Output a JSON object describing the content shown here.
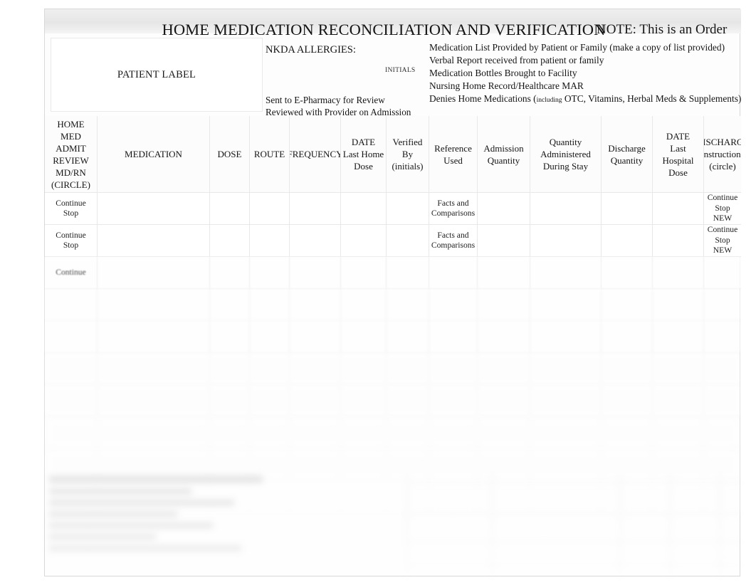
{
  "document": {
    "title_main": "HOME MEDICATION RECONCILIATION AND VERIFICATION",
    "title_note": "NOTE: This is an Order"
  },
  "header": {
    "patient_label": "PATIENT LABEL",
    "allergies_label": "NKDA ALLERGIES:",
    "initials_label": "INITIALS",
    "allergy_actions": [
      "Sent to E-Pharmacy for Review",
      "Reviewed with Provider on Admission"
    ],
    "information_sources": [
      "Medication List Provided by Patient or Family (make a copy of list provided)",
      "Verbal Report received from patient or family",
      "Medication Bottles Brought to Facility",
      "Nursing Home Record/Healthcare MAR"
    ],
    "denies_prefix": "Denies Home Medications (",
    "denies_small": "including",
    "denies_suffix": " OTC, Vitamins, Herbal Meds & Supplements)"
  },
  "table": {
    "columns": [
      {
        "key": "review",
        "label": "HOME MED ADMIT REVIEW MD/RN (CIRCLE)",
        "lines": [
          "HOME",
          "MED",
          "ADMIT",
          "REVIEW",
          "MD/RN",
          "(CIRCLE)"
        ]
      },
      {
        "key": "medication",
        "label": "MEDICATION",
        "lines": [
          "MEDICATION"
        ]
      },
      {
        "key": "dose",
        "label": "DOSE",
        "lines": [
          "DOSE"
        ]
      },
      {
        "key": "route",
        "label": "ROUTE",
        "lines": [
          "ROUTE"
        ]
      },
      {
        "key": "frequency",
        "label": "FREQUENCY",
        "lines": [
          "FREQUENCY"
        ]
      },
      {
        "key": "date_last_home_dose",
        "label": "DATE Last Home Dose",
        "lines": [
          "DATE",
          "Last Home",
          "Dose"
        ]
      },
      {
        "key": "verified_by",
        "label": "Verified By (initials)",
        "lines": [
          "Verified",
          "By",
          "(initials)"
        ]
      },
      {
        "key": "reference_used",
        "label": "Reference Used",
        "lines": [
          "Reference",
          "Used"
        ]
      },
      {
        "key": "admission_quantity",
        "label": "Admission Quantity",
        "lines": [
          "Admission",
          "Quantity"
        ]
      },
      {
        "key": "quantity_administered",
        "label": "Quantity Administered During Stay",
        "lines": [
          "Quantity",
          "Administered",
          "During Stay"
        ]
      },
      {
        "key": "discharge_quantity",
        "label": "Discharge Quantity",
        "lines": [
          "Discharge",
          "Quantity"
        ]
      },
      {
        "key": "date_last_hospital_dose",
        "label": "DATE Last Hospital Dose",
        "lines": [
          "DATE",
          "Last",
          "Hospital",
          "Dose"
        ]
      },
      {
        "key": "discharge_instructions",
        "label": "DISCHARGE Instructions (circle)",
        "lines": [
          "DISCHARGE",
          "Instructions",
          "(circle)"
        ]
      }
    ],
    "rows": [
      {
        "review": [
          "Continue",
          "Stop"
        ],
        "medication": "",
        "dose": "",
        "route": "",
        "frequency": "",
        "date_last_home_dose": "",
        "verified_by": "",
        "reference_used": [
          "Facts and",
          "Comparisons"
        ],
        "admission_quantity": "",
        "quantity_administered": "",
        "discharge_quantity": "",
        "date_last_hospital_dose": "",
        "discharge_instructions": [
          "Continue",
          "Stop",
          "NEW"
        ]
      },
      {
        "review": [
          "Continue",
          "Stop"
        ],
        "medication": "",
        "dose": "",
        "route": "",
        "frequency": "",
        "date_last_home_dose": "",
        "verified_by": "",
        "reference_used": [
          "Facts and",
          "Comparisons"
        ],
        "admission_quantity": "",
        "quantity_administered": "",
        "discharge_quantity": "",
        "date_last_hospital_dose": "",
        "discharge_instructions": [
          "Continue",
          "Stop",
          "NEW"
        ]
      },
      {
        "review": [
          "Continue"
        ],
        "medication": "",
        "dose": "",
        "route": "",
        "frequency": "",
        "date_last_home_dose": "",
        "verified_by": "",
        "reference_used": [],
        "admission_quantity": "",
        "quantity_administered": "",
        "discharge_quantity": "",
        "date_last_hospital_dose": "",
        "discharge_instructions": []
      },
      {
        "review": [],
        "medication": "",
        "dose": "",
        "route": "",
        "frequency": "",
        "date_last_home_dose": "",
        "verified_by": "",
        "reference_used": [],
        "admission_quantity": "",
        "quantity_administered": "",
        "discharge_quantity": "",
        "date_last_hospital_dose": "",
        "discharge_instructions": []
      },
      {
        "review": [],
        "medication": "",
        "dose": "",
        "route": "",
        "frequency": "",
        "date_last_home_dose": "",
        "verified_by": "",
        "reference_used": [],
        "admission_quantity": "",
        "quantity_administered": "",
        "discharge_quantity": "",
        "date_last_hospital_dose": "",
        "discharge_instructions": []
      },
      {
        "review": [],
        "medication": "",
        "dose": "",
        "route": "",
        "frequency": "",
        "date_last_home_dose": "",
        "verified_by": "",
        "reference_used": [],
        "admission_quantity": "",
        "quantity_administered": "",
        "discharge_quantity": "",
        "date_last_hospital_dose": "",
        "discharge_instructions": []
      },
      {
        "review": [],
        "medication": "",
        "dose": "",
        "route": "",
        "frequency": "",
        "date_last_home_dose": "",
        "verified_by": "",
        "reference_used": [],
        "admission_quantity": "",
        "quantity_administered": "",
        "discharge_quantity": "",
        "date_last_hospital_dose": "",
        "discharge_instructions": []
      },
      {
        "review": [],
        "medication": "",
        "dose": "",
        "route": "",
        "frequency": "",
        "date_last_home_dose": "",
        "verified_by": "",
        "reference_used": [],
        "admission_quantity": "",
        "quantity_administered": "",
        "discharge_quantity": "",
        "date_last_hospital_dose": "",
        "discharge_instructions": []
      },
      {
        "review": [],
        "medication": "",
        "dose": "",
        "route": "",
        "frequency": "",
        "date_last_home_dose": "",
        "verified_by": "",
        "reference_used": [],
        "admission_quantity": "",
        "quantity_administered": "",
        "discharge_quantity": "",
        "date_last_hospital_dose": "",
        "discharge_instructions": []
      },
      {
        "review": [],
        "medication": "",
        "dose": "",
        "route": "",
        "frequency": "",
        "date_last_home_dose": "",
        "verified_by": "",
        "reference_used": [],
        "admission_quantity": "",
        "quantity_administered": "",
        "discharge_quantity": "",
        "date_last_hospital_dose": "",
        "discharge_instructions": []
      }
    ]
  }
}
